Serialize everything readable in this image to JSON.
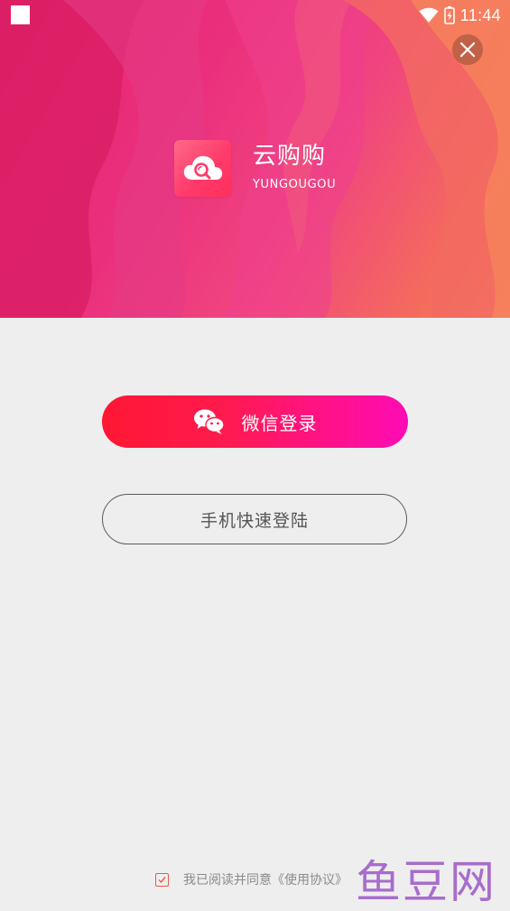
{
  "status_bar": {
    "time": "11:44"
  },
  "brand": {
    "name": "云购购",
    "subtitle": "YUNGOUGOU"
  },
  "actions": {
    "wechat_login": "微信登录",
    "phone_login": "手机快速登陆"
  },
  "agreement": {
    "text": "我已阅读并同意《使用协议》"
  },
  "watermark": {
    "text": "鱼豆网"
  },
  "icons": {
    "status_square": "square-icon",
    "wifi": "wifi-icon",
    "battery": "battery-charging-icon",
    "close": "close-icon",
    "logo": "cloud-search-logo",
    "wechat": "wechat-icon",
    "checkbox": "checkbox-checked-icon"
  },
  "colors": {
    "wechat_gradient_start": "#ff1733",
    "wechat_gradient_end": "#ff0bb5",
    "background": "#efeeee",
    "checkbox": "#e25b4b"
  }
}
